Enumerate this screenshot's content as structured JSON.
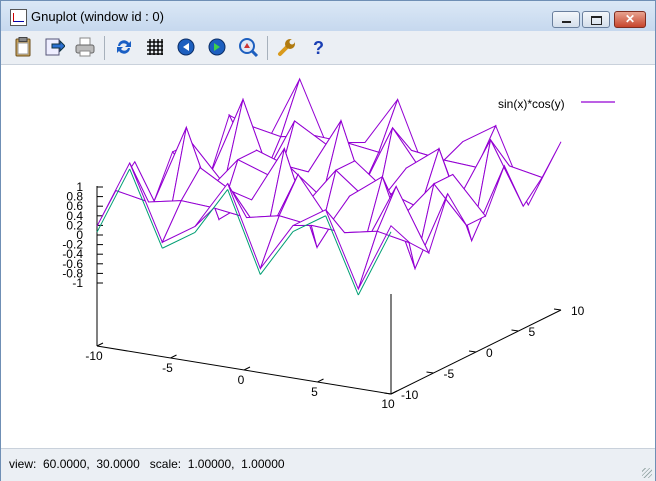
{
  "window": {
    "title": "Gnuplot (window id : 0)"
  },
  "toolbar": {
    "buttons": [
      {
        "name": "copy-clipboard-icon"
      },
      {
        "name": "export-icon"
      },
      {
        "name": "print-icon"
      },
      {
        "name": "replot-icon"
      },
      {
        "name": "grid-icon"
      },
      {
        "name": "zoom-previous-icon"
      },
      {
        "name": "zoom-next-icon"
      },
      {
        "name": "unzoom-icon"
      },
      {
        "name": "options-wrench-icon"
      },
      {
        "name": "help-icon"
      }
    ]
  },
  "plot": {
    "legend_label": "sin(x)*cos(y)",
    "z_ticks": [
      "1",
      "0.8",
      "0.6",
      "0.4",
      "0.2",
      "0",
      "-0.2",
      "-0.4",
      "-0.6",
      "-0.8",
      "-1"
    ],
    "x_ticks": [
      "-10",
      "-5",
      "0",
      "5",
      "10"
    ],
    "y_ticks": [
      "-10",
      "-5",
      "0",
      "5",
      "10"
    ],
    "top_color": "#9400d3",
    "bottom_color": "#009e73"
  },
  "chart_data": {
    "type": "surface",
    "function": "sin(x)*cos(y)",
    "xrange": [
      -10,
      10
    ],
    "yrange": [
      -10,
      10
    ],
    "zrange": [
      -1,
      1
    ],
    "samples": 10,
    "series": [
      {
        "name": "sin(x)*cos(y)",
        "color": "#9400d3"
      }
    ]
  },
  "status": {
    "text": "view:  60.0000,  30.0000   scale:  1.00000,  1.00000"
  }
}
